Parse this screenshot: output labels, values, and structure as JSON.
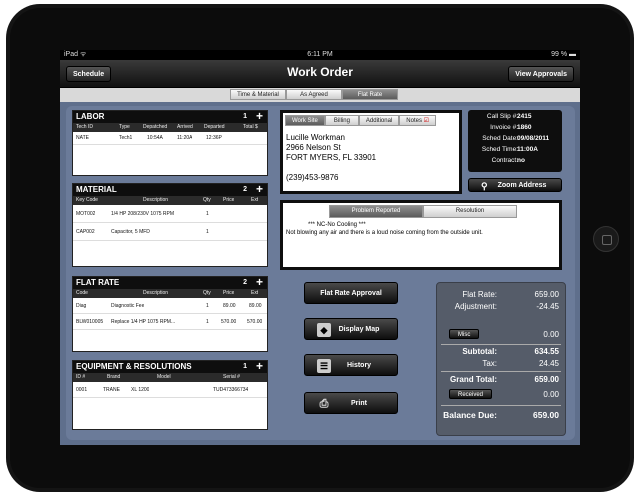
{
  "status_bar": {
    "carrier": "iPad ᯤ",
    "time": "6:11 PM",
    "battery": "99 % ▬"
  },
  "nav": {
    "back_label": "Schedule",
    "title": "Work Order",
    "right_label": "View Approvals"
  },
  "mode_tabs": [
    {
      "label": "Time & Material",
      "active": false
    },
    {
      "label": "As Agreed",
      "active": false
    },
    {
      "label": "Flat Rate",
      "active": true
    }
  ],
  "labor": {
    "title": "LABOR",
    "count": "1",
    "plus": "+",
    "columns": [
      "Tech ID",
      "Type",
      "Depatched",
      "Arrived",
      "Departed",
      "Total $"
    ],
    "rows": [
      [
        "NATE",
        "Tech1",
        "10:54A",
        "11:20A",
        "12:36P",
        ""
      ]
    ]
  },
  "material": {
    "title": "MATERIAL",
    "count": "2",
    "plus": "+",
    "columns": [
      "Key Code",
      "Description",
      "Qty",
      "Price",
      "Ext"
    ],
    "rows": [
      [
        "MOT002",
        "1/4 HP 208/230V 1075 RPM",
        "1",
        "",
        ""
      ],
      [
        "CAP002",
        "Capacitor, 5 MFD",
        "1",
        "",
        ""
      ]
    ]
  },
  "flat_rate": {
    "title": "FLAT RATE",
    "count": "2",
    "plus": "+",
    "columns": [
      "Code",
      "Description",
      "Qty",
      "Price",
      "Ext"
    ],
    "rows": [
      [
        "Diag",
        "Diagnostic Fee",
        "1",
        "89.00",
        "89.00"
      ],
      [
        "BLW010005",
        "Replace 1/4 HP 1075 RPM...",
        "1",
        "570.00",
        "570.00"
      ]
    ]
  },
  "equipment": {
    "title": "EQUIPMENT & RESOLUTIONS",
    "count": "1",
    "plus": "+",
    "columns": [
      "ID #",
      "Brand",
      "Model",
      "Serial #"
    ],
    "rows": [
      [
        "0001",
        "TRANE",
        "XL 1200",
        "TUD473366734"
      ]
    ]
  },
  "site": {
    "tabs": [
      {
        "label": "Work Site",
        "active": true
      },
      {
        "label": "Billing",
        "active": false
      },
      {
        "label": "Additional",
        "active": false
      },
      {
        "label": "Notes",
        "active": false
      }
    ],
    "notes_check": "☑",
    "name": "Lucille Workman",
    "street": "2966 Nelson St",
    "city": "FORT MYERS, FL 33901",
    "phone": "(239)453-9876"
  },
  "call_info": [
    {
      "label": "Call Slip #:",
      "value": "2415"
    },
    {
      "label": "Invoice #:",
      "value": "1860"
    },
    {
      "label": "Sched Date:",
      "value": "09/08/2011"
    },
    {
      "label": "Sched Time:",
      "value": "11:00A"
    },
    {
      "label": "Contract:",
      "value": "no"
    }
  ],
  "zoom_button": "Zoom Address",
  "problem": {
    "tabs": [
      {
        "label": "Problem Reported",
        "active": true
      },
      {
        "label": "Resolution",
        "active": false
      }
    ],
    "line1": "***  NC-No Cooling  ***",
    "line2": "Not blowing any air and there is a loud noise coming from the outside unit."
  },
  "actions": {
    "flat_rate_approval": "Flat Rate Approval",
    "display_map": "Display Map",
    "history": "History",
    "print": "Print"
  },
  "icons": {
    "map": "map-icon",
    "history": "list-icon",
    "print": "printer-icon",
    "zoom": "magnifier-icon"
  },
  "totals": {
    "flat_rate_label": "Flat Rate:",
    "flat_rate": "659.00",
    "adjustment_label": "Adjustment:",
    "adjustment": "-24.45",
    "misc_label": "Misc",
    "misc": "0.00",
    "subtotal_label": "Subtotal:",
    "subtotal": "634.55",
    "tax_label": "Tax:",
    "tax": "24.45",
    "grand_total_label": "Grand Total:",
    "grand_total": "659.00",
    "received_label": "Received",
    "received": "0.00",
    "balance_due_label": "Balance Due:",
    "balance_due": "659.00"
  }
}
